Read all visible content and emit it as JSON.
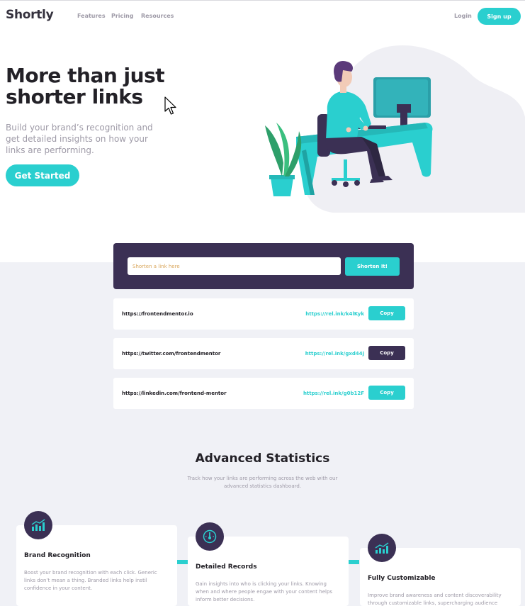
{
  "header": {
    "logo": "Shortly",
    "nav": [
      "Features",
      "Pricing",
      "Resources"
    ],
    "login": "Login",
    "signup": "Sign up"
  },
  "hero": {
    "title": "More than just shorter links",
    "subtitle": "Build your brand’s recognition and get detailed insights on how your links are performing.",
    "cta": "Get Started"
  },
  "shorten": {
    "placeholder": "Shorten a link here",
    "button": "Shorten It!"
  },
  "results": [
    {
      "original": "https://frontendmentor.io",
      "short": "https://rel.ink/k4lKyk",
      "copy": "Copy",
      "state": "default"
    },
    {
      "original": "https://twitter.com/frontendmentor",
      "short": "https://rel.ink/gxd44j",
      "copy": "Copy",
      "state": "copied"
    },
    {
      "original": "https://linkedin.com/frontend-mentor",
      "short": "https://rel.ink/g0b12F",
      "copy": "Copy",
      "state": "default"
    }
  ],
  "stats": {
    "title": "Advanced Statistics",
    "subtitle": "Track how your links are performing across the web with our advanced statistics dashboard.",
    "cards": [
      {
        "icon": "bar-chart-icon",
        "title": "Brand Recognition",
        "text": "Boost your brand recognition with each click. Generic links don’t mean a thing. Branded links help instil confidence in your content."
      },
      {
        "icon": "gauge-icon",
        "title": "Detailed Records",
        "text": "Gain insights into who is clicking your links. Knowing when and where people engae with your content helps inform better decisions."
      },
      {
        "icon": "brush-chart-icon",
        "title": "Fully Customizable",
        "text": "Improve brand awareness and content discoverability through customizable links, supercharging audience engagement."
      }
    ]
  },
  "colors": {
    "accent": "#2acfcf",
    "dark_violet": "#3b3054",
    "grey_text": "#9e9aa7",
    "bg_grey": "#f0f1f6"
  }
}
